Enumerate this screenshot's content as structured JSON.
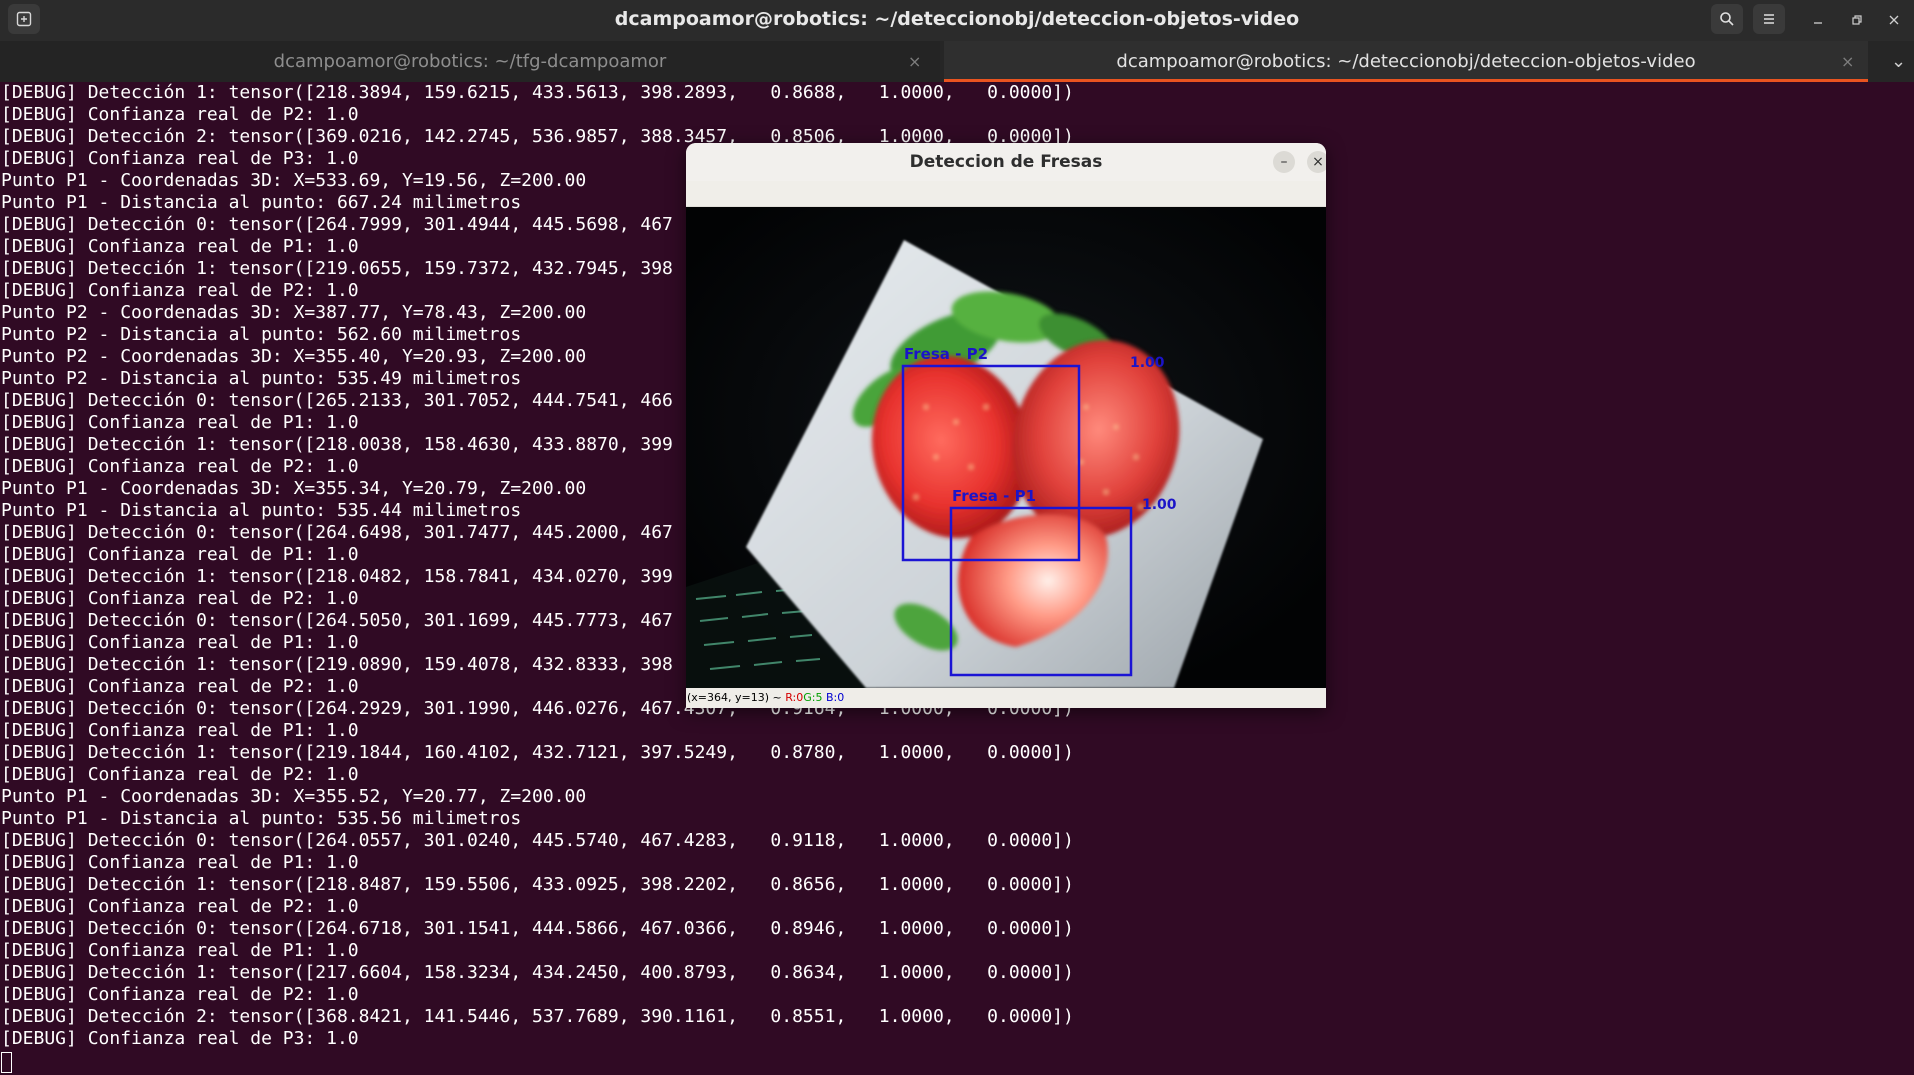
{
  "window": {
    "title": "dcampoamor@robotics: ~/deteccionobj/deteccion-objetos-video",
    "icons": [
      "new-tab-icon",
      "search-icon",
      "hamburger-menu-icon",
      "minimize-icon",
      "restore-icon",
      "close-icon"
    ]
  },
  "tabs": [
    {
      "label": "dcampoamor@robotics: ~/tfg-dcampoamor",
      "active": false,
      "close": "×"
    },
    {
      "label": "dcampoamor@robotics: ~/deteccionobj/deteccion-objetos-video",
      "active": true,
      "close": "×"
    }
  ],
  "tab_overflow": "⌄",
  "terminal": {
    "lines": [
      "[DEBUG] Detección 1: tensor([218.3894, 159.6215, 433.5613, 398.2893,   0.8688,   1.0000,   0.0000])",
      "[DEBUG] Confianza real de P2: 1.0",
      "[DEBUG] Detección 2: tensor([369.0216, 142.2745, 536.9857, 388.3457,   0.8506,   1.0000,   0.0000])",
      "[DEBUG] Confianza real de P3: 1.0",
      "Punto P1 - Coordenadas 3D: X=533.69, Y=19.56, Z=200.00",
      "Punto P1 - Distancia al punto: 667.24 milimetros",
      "[DEBUG] Detección 0: tensor([264.7999, 301.4944, 445.5698, 467",
      "[DEBUG] Confianza real de P1: 1.0",
      "[DEBUG] Detección 1: tensor([219.0655, 159.7372, 432.7945, 398",
      "[DEBUG] Confianza real de P2: 1.0",
      "Punto P2 - Coordenadas 3D: X=387.77, Y=78.43, Z=200.00",
      "Punto P2 - Distancia al punto: 562.60 milimetros",
      "Punto P2 - Coordenadas 3D: X=355.40, Y=20.93, Z=200.00",
      "Punto P2 - Distancia al punto: 535.49 milimetros",
      "[DEBUG] Detección 0: tensor([265.2133, 301.7052, 444.7541, 466",
      "[DEBUG] Confianza real de P1: 1.0",
      "[DEBUG] Detección 1: tensor([218.0038, 158.4630, 433.8870, 399",
      "[DEBUG] Confianza real de P2: 1.0",
      "Punto P1 - Coordenadas 3D: X=355.34, Y=20.79, Z=200.00",
      "Punto P1 - Distancia al punto: 535.44 milimetros",
      "[DEBUG] Detección 0: tensor([264.6498, 301.7477, 445.2000, 467",
      "[DEBUG] Confianza real de P1: 1.0",
      "[DEBUG] Detección 1: tensor([218.0482, 158.7841, 434.0270, 399",
      "[DEBUG] Confianza real de P2: 1.0",
      "[DEBUG] Detección 0: tensor([264.5050, 301.1699, 445.7773, 467",
      "[DEBUG] Confianza real de P1: 1.0",
      "[DEBUG] Detección 1: tensor([219.0890, 159.4078, 432.8333, 398",
      "[DEBUG] Confianza real de P2: 1.0",
      "[DEBUG] Detección 0: tensor([264.2929, 301.1990, 446.0276, 467.4307,   0.9164,   1.0000,   0.0000])",
      "[DEBUG] Confianza real de P1: 1.0",
      "[DEBUG] Detección 1: tensor([219.1844, 160.4102, 432.7121, 397.5249,   0.8780,   1.0000,   0.0000])",
      "[DEBUG] Confianza real de P2: 1.0",
      "Punto P1 - Coordenadas 3D: X=355.52, Y=20.77, Z=200.00",
      "Punto P1 - Distancia al punto: 535.56 milimetros",
      "[DEBUG] Detección 0: tensor([264.0557, 301.0240, 445.5740, 467.4283,   0.9118,   1.0000,   0.0000])",
      "[DEBUG] Confianza real de P1: 1.0",
      "[DEBUG] Detección 1: tensor([218.8487, 159.5506, 433.0925, 398.2202,   0.8656,   1.0000,   0.0000])",
      "[DEBUG] Confianza real de P2: 1.0",
      "[DEBUG] Detección 0: tensor([264.6718, 301.1541, 444.5866, 467.0366,   0.8946,   1.0000,   0.0000])",
      "[DEBUG] Confianza real de P1: 1.0",
      "[DEBUG] Detección 1: tensor([217.6604, 158.3234, 434.2450, 400.8793,   0.8634,   1.0000,   0.0000])",
      "[DEBUG] Confianza real de P2: 1.0",
      "[DEBUG] Detección 2: tensor([368.8421, 141.5446, 537.7689, 390.1161,   0.8551,   1.0000,   0.0000])",
      "[DEBUG] Confianza real de P3: 1.0"
    ]
  },
  "detection_window": {
    "title": "Deteccion de Fresas",
    "minimize": "–",
    "close": "×",
    "detections": [
      {
        "label": "Fresa - P2",
        "score": "1.00"
      },
      {
        "label": "Fresa - P1",
        "score": "1.00"
      }
    ],
    "status": {
      "coords": "(x=364, y=13) ~",
      "r": "R:0",
      "g": "G:5",
      "b": "B:0"
    },
    "colors": {
      "box": "#1b14d4",
      "label": "#1b14c8",
      "status_r": "#d40000",
      "status_g": "#00a000",
      "status_b": "#0000d0"
    }
  },
  "colors": {
    "terminal_bg": "#300a24",
    "terminal_fg": "#ffffff",
    "active_tab_accent": "#e95420"
  }
}
